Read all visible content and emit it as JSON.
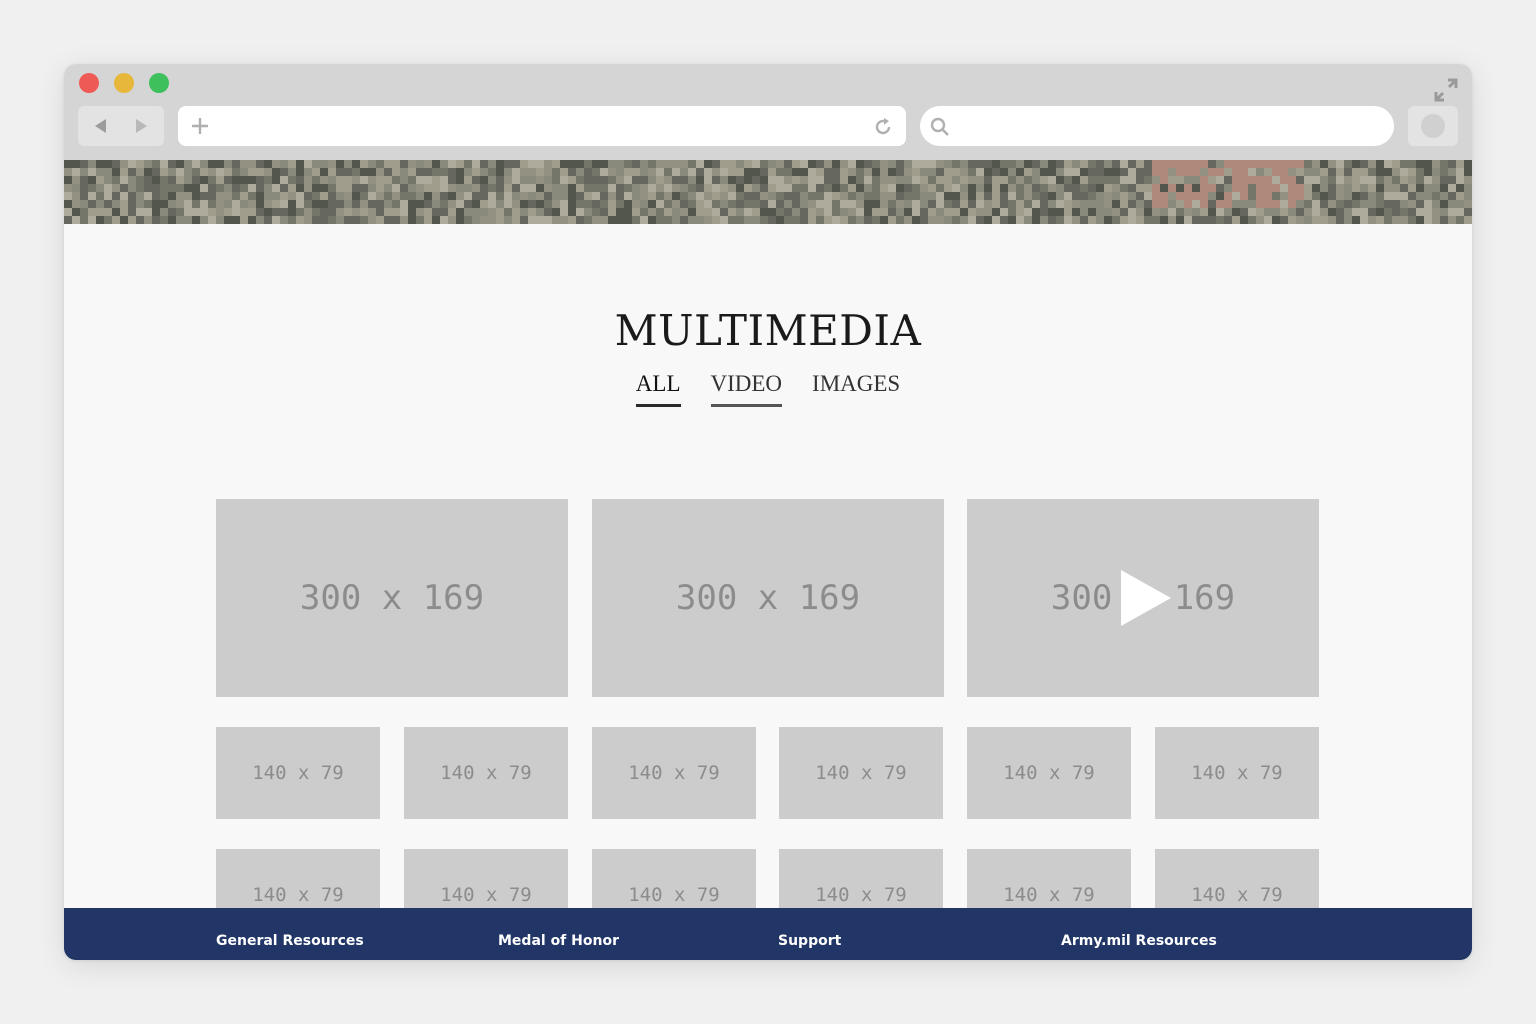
{
  "browser": {
    "address_value": "",
    "search_value": "",
    "icons": [
      "close-dot",
      "minimize-dot",
      "zoom-dot",
      "expand-icon",
      "back-arrow-icon",
      "forward-arrow-icon",
      "plus-icon",
      "reload-icon",
      "search-icon",
      "extension-icon"
    ]
  },
  "page": {
    "title": "MULTIMEDIA",
    "tabs": [
      {
        "label": "ALL"
      },
      {
        "label": "VIDEO"
      },
      {
        "label": "IMAGES"
      }
    ],
    "featured": [
      {
        "label": "300 x 169"
      },
      {
        "label": "300 x 169"
      },
      {
        "label": "300 x 169",
        "video": true
      }
    ],
    "thumbnails_row1": [
      {
        "label": "140 x 79"
      },
      {
        "label": "140 x 79"
      },
      {
        "label": "140 x 79"
      },
      {
        "label": "140 x 79"
      },
      {
        "label": "140 x 79"
      },
      {
        "label": "140 x 79"
      }
    ],
    "thumbnails_row2": [
      {
        "label": "140 x 79"
      },
      {
        "label": "140 x 79"
      },
      {
        "label": "140 x 79"
      },
      {
        "label": "140 x 79"
      },
      {
        "label": "140 x 79"
      },
      {
        "label": "140 x 79"
      }
    ]
  },
  "footer": {
    "links": [
      {
        "label": "General Resources"
      },
      {
        "label": "Medal of Honor"
      },
      {
        "label": "Support"
      },
      {
        "label": "Army.mil Resources"
      }
    ]
  },
  "colors": {
    "footer_bg": "#213667",
    "placeholder_bg": "#cccccc",
    "placeholder_text": "#8c8c8c",
    "chrome_bg": "#d5d5d5",
    "dot_red": "#ee5a56",
    "dot_yellow": "#e6b73a",
    "dot_green": "#3ec05c"
  }
}
